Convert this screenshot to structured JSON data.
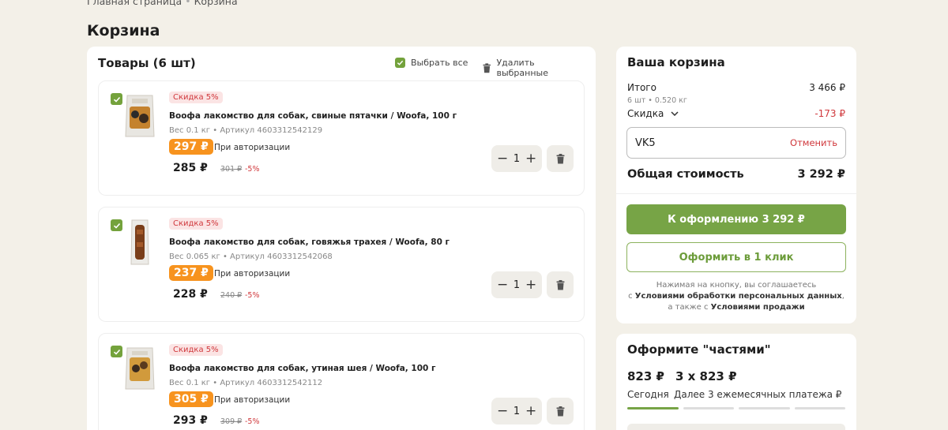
{
  "breadcrumb": {
    "home": "Главная страница",
    "current": "Корзина"
  },
  "page_title": "Корзина",
  "cart": {
    "title": "Товары (6 шт)",
    "select_all": "Выбрать все",
    "delete_selected": "Удалить выбранные",
    "items": [
      {
        "badge": "Скидка 5%",
        "name": "Воофа лакомство для собак, свиные пятачки / Woofa, 100 г",
        "meta": "Вес 0.1 кг • Артикул 4603312542129",
        "auth_price": "297 ₽",
        "auth_note": "При авторизации",
        "price": "285 ₽",
        "old_price": "301 ₽",
        "pct": "-5%",
        "qty": "1"
      },
      {
        "badge": "Скидка 5%",
        "name": "Воофа лакомство для собак, говяжья трахея / Woofa, 80 г",
        "meta": "Вес 0.065 кг • Артикул 4603312542068",
        "auth_price": "237 ₽",
        "auth_note": "При авторизации",
        "price": "228 ₽",
        "old_price": "240 ₽",
        "pct": "-5%",
        "qty": "1"
      },
      {
        "badge": "Скидка 5%",
        "name": "Воофа лакомство для собак, утиная шея / Woofa, 100 г",
        "meta": "Вес 0.1 кг • Артикул 4603312542112",
        "auth_price": "305 ₽",
        "auth_note": "При авторизации",
        "price": "293 ₽",
        "old_price": "309 ₽",
        "pct": "-5%",
        "qty": "1"
      }
    ]
  },
  "summary": {
    "title": "Ваша корзина",
    "subtotal_label": "Итого",
    "subtotal_value": "3 466 ₽",
    "subtotal_sub": "6 шт • 0.520 кг",
    "discount_label": "Скидка",
    "discount_value": "-173 ₽",
    "promo_code": "VK5",
    "promo_cancel": "Отменить",
    "total_label": "Общая стоимость",
    "total_value": "3 292 ₽",
    "checkout_label": "К оформлению 3 292 ₽",
    "oneclick_label": "Оформить в 1 клик",
    "terms_1": "Нажимая на кнопку, вы соглашаетесь",
    "terms_2": "с ",
    "terms_link1": "Условиями обработки персональных данных",
    "terms_3": ",",
    "terms_4": "а также с ",
    "terms_link2": "Условиями продажи"
  },
  "installments": {
    "title": "Оформите \"частями\"",
    "today_amount": "823 ₽",
    "later_amount": "3 x 823 ₽",
    "today_label": "Сегодня",
    "later_label": "Далее 3 ежемесячных платежа ₽"
  },
  "colors": {
    "accent_green": "#77a446",
    "discount_red": "#d0383c",
    "auth_orange": "#f7931e",
    "background": "#f3f0e8"
  }
}
